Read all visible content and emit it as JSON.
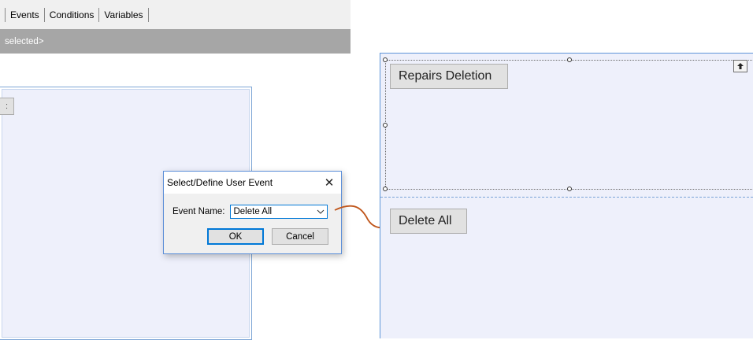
{
  "tabs": [
    {
      "label": "Events"
    },
    {
      "label": "Conditions"
    },
    {
      "label": "Variables"
    }
  ],
  "status_text": "selected>",
  "left_canvas_button_label": ":",
  "dialog": {
    "title": "Select/Define User Event",
    "close_glyph": "✕",
    "field_label": "Event Name:",
    "event_name_value": "Delete All",
    "ok_label": "OK",
    "cancel_label": "Cancel"
  },
  "designer": {
    "repairs_button_label": "Repairs Deletion",
    "delete_all_button_label": "Delete All"
  },
  "colors": {
    "accent": "#0078d7",
    "canvas_bg": "#eef0fb",
    "status_strip": "#a6a6a6",
    "arrow": "#c0561b"
  }
}
